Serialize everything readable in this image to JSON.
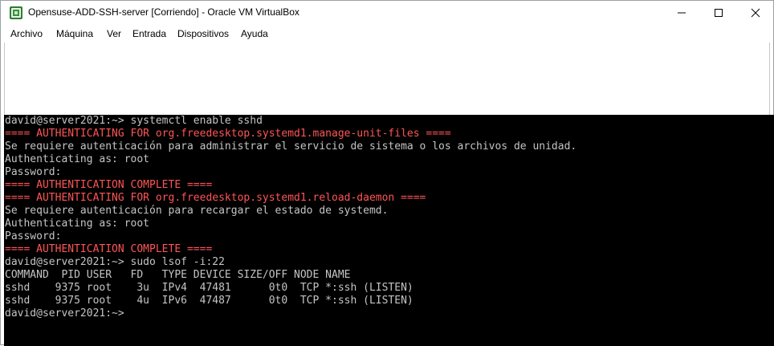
{
  "window": {
    "title": "Opensuse-ADD-SSH-server [Corriendo] - Oracle VM VirtualBox"
  },
  "menubar": {
    "items": [
      "Archivo",
      "Máquina",
      "Ver",
      "Entrada",
      "Dispositivos",
      "Ayuda"
    ]
  },
  "console": {
    "lines": [
      {
        "text": "david@server2021:~> systemctl enable sshd",
        "color": "#c4c4c4"
      },
      {
        "text": "==== AUTHENTICATING FOR org.freedesktop.systemd1.manage-unit-files ====",
        "color": "#ff5555"
      },
      {
        "text": "Se requiere autenticación para administrar el servicio de sistema o los archivos de unidad.",
        "color": "#c4c4c4"
      },
      {
        "text": "Authenticating as: root",
        "color": "#c4c4c4"
      },
      {
        "text": "Password:",
        "color": "#c4c4c4"
      },
      {
        "text": "==== AUTHENTICATION COMPLETE ====",
        "color": "#ff5555"
      },
      {
        "text": "==== AUTHENTICATING FOR org.freedesktop.systemd1.reload-daemon ====",
        "color": "#ff5555"
      },
      {
        "text": "Se requiere autenticación para recargar el estado de systemd.",
        "color": "#c4c4c4"
      },
      {
        "text": "Authenticating as: root",
        "color": "#c4c4c4"
      },
      {
        "text": "Password:",
        "color": "#c4c4c4"
      },
      {
        "text": "==== AUTHENTICATION COMPLETE ====",
        "color": "#ff5555"
      },
      {
        "text": "david@server2021:~> sudo lsof -i:22",
        "color": "#c4c4c4"
      },
      {
        "text": "COMMAND  PID USER   FD   TYPE DEVICE SIZE/OFF NODE NAME",
        "color": "#c4c4c4"
      },
      {
        "text": "sshd    9375 root    3u  IPv4  47481      0t0  TCP *:ssh (LISTEN)",
        "color": "#c4c4c4"
      },
      {
        "text": "sshd    9375 root    4u  IPv6  47487      0t0  TCP *:ssh (LISTEN)",
        "color": "#c4c4c4"
      },
      {
        "text": "david@server2021:~> ",
        "color": "#c4c4c4"
      }
    ]
  },
  "icons": {
    "app": "virtualbox-icon",
    "minimize": "minimize-icon",
    "maximize": "maximize-icon",
    "close": "close-icon"
  }
}
